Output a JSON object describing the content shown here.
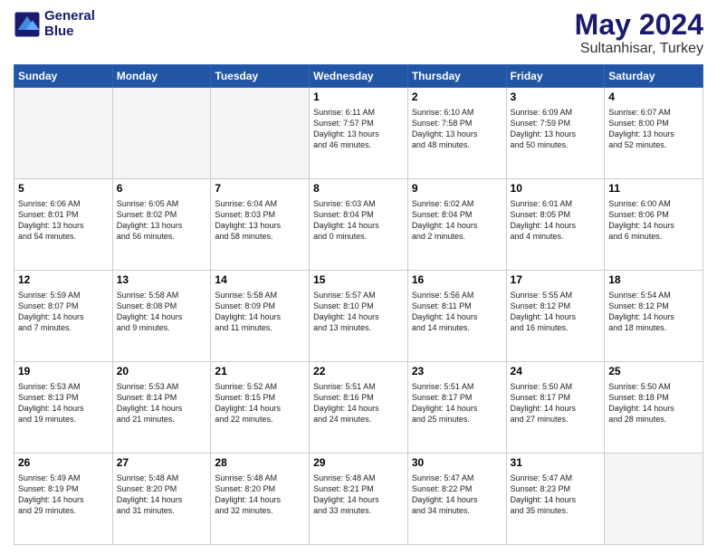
{
  "header": {
    "logo_line1": "General",
    "logo_line2": "Blue",
    "title": "May 2024",
    "subtitle": "Sultanhisar, Turkey"
  },
  "weekdays": [
    "Sunday",
    "Monday",
    "Tuesday",
    "Wednesday",
    "Thursday",
    "Friday",
    "Saturday"
  ],
  "weeks": [
    [
      {
        "day": "",
        "info": ""
      },
      {
        "day": "",
        "info": ""
      },
      {
        "day": "",
        "info": ""
      },
      {
        "day": "1",
        "info": "Sunrise: 6:11 AM\nSunset: 7:57 PM\nDaylight: 13 hours\nand 46 minutes."
      },
      {
        "day": "2",
        "info": "Sunrise: 6:10 AM\nSunset: 7:58 PM\nDaylight: 13 hours\nand 48 minutes."
      },
      {
        "day": "3",
        "info": "Sunrise: 6:09 AM\nSunset: 7:59 PM\nDaylight: 13 hours\nand 50 minutes."
      },
      {
        "day": "4",
        "info": "Sunrise: 6:07 AM\nSunset: 8:00 PM\nDaylight: 13 hours\nand 52 minutes."
      }
    ],
    [
      {
        "day": "5",
        "info": "Sunrise: 6:06 AM\nSunset: 8:01 PM\nDaylight: 13 hours\nand 54 minutes."
      },
      {
        "day": "6",
        "info": "Sunrise: 6:05 AM\nSunset: 8:02 PM\nDaylight: 13 hours\nand 56 minutes."
      },
      {
        "day": "7",
        "info": "Sunrise: 6:04 AM\nSunset: 8:03 PM\nDaylight: 13 hours\nand 58 minutes."
      },
      {
        "day": "8",
        "info": "Sunrise: 6:03 AM\nSunset: 8:04 PM\nDaylight: 14 hours\nand 0 minutes."
      },
      {
        "day": "9",
        "info": "Sunrise: 6:02 AM\nSunset: 8:04 PM\nDaylight: 14 hours\nand 2 minutes."
      },
      {
        "day": "10",
        "info": "Sunrise: 6:01 AM\nSunset: 8:05 PM\nDaylight: 14 hours\nand 4 minutes."
      },
      {
        "day": "11",
        "info": "Sunrise: 6:00 AM\nSunset: 8:06 PM\nDaylight: 14 hours\nand 6 minutes."
      }
    ],
    [
      {
        "day": "12",
        "info": "Sunrise: 5:59 AM\nSunset: 8:07 PM\nDaylight: 14 hours\nand 7 minutes."
      },
      {
        "day": "13",
        "info": "Sunrise: 5:58 AM\nSunset: 8:08 PM\nDaylight: 14 hours\nand 9 minutes."
      },
      {
        "day": "14",
        "info": "Sunrise: 5:58 AM\nSunset: 8:09 PM\nDaylight: 14 hours\nand 11 minutes."
      },
      {
        "day": "15",
        "info": "Sunrise: 5:57 AM\nSunset: 8:10 PM\nDaylight: 14 hours\nand 13 minutes."
      },
      {
        "day": "16",
        "info": "Sunrise: 5:56 AM\nSunset: 8:11 PM\nDaylight: 14 hours\nand 14 minutes."
      },
      {
        "day": "17",
        "info": "Sunrise: 5:55 AM\nSunset: 8:12 PM\nDaylight: 14 hours\nand 16 minutes."
      },
      {
        "day": "18",
        "info": "Sunrise: 5:54 AM\nSunset: 8:12 PM\nDaylight: 14 hours\nand 18 minutes."
      }
    ],
    [
      {
        "day": "19",
        "info": "Sunrise: 5:53 AM\nSunset: 8:13 PM\nDaylight: 14 hours\nand 19 minutes."
      },
      {
        "day": "20",
        "info": "Sunrise: 5:53 AM\nSunset: 8:14 PM\nDaylight: 14 hours\nand 21 minutes."
      },
      {
        "day": "21",
        "info": "Sunrise: 5:52 AM\nSunset: 8:15 PM\nDaylight: 14 hours\nand 22 minutes."
      },
      {
        "day": "22",
        "info": "Sunrise: 5:51 AM\nSunset: 8:16 PM\nDaylight: 14 hours\nand 24 minutes."
      },
      {
        "day": "23",
        "info": "Sunrise: 5:51 AM\nSunset: 8:17 PM\nDaylight: 14 hours\nand 25 minutes."
      },
      {
        "day": "24",
        "info": "Sunrise: 5:50 AM\nSunset: 8:17 PM\nDaylight: 14 hours\nand 27 minutes."
      },
      {
        "day": "25",
        "info": "Sunrise: 5:50 AM\nSunset: 8:18 PM\nDaylight: 14 hours\nand 28 minutes."
      }
    ],
    [
      {
        "day": "26",
        "info": "Sunrise: 5:49 AM\nSunset: 8:19 PM\nDaylight: 14 hours\nand 29 minutes."
      },
      {
        "day": "27",
        "info": "Sunrise: 5:48 AM\nSunset: 8:20 PM\nDaylight: 14 hours\nand 31 minutes."
      },
      {
        "day": "28",
        "info": "Sunrise: 5:48 AM\nSunset: 8:20 PM\nDaylight: 14 hours\nand 32 minutes."
      },
      {
        "day": "29",
        "info": "Sunrise: 5:48 AM\nSunset: 8:21 PM\nDaylight: 14 hours\nand 33 minutes."
      },
      {
        "day": "30",
        "info": "Sunrise: 5:47 AM\nSunset: 8:22 PM\nDaylight: 14 hours\nand 34 minutes."
      },
      {
        "day": "31",
        "info": "Sunrise: 5:47 AM\nSunset: 8:23 PM\nDaylight: 14 hours\nand 35 minutes."
      },
      {
        "day": "",
        "info": ""
      }
    ]
  ]
}
